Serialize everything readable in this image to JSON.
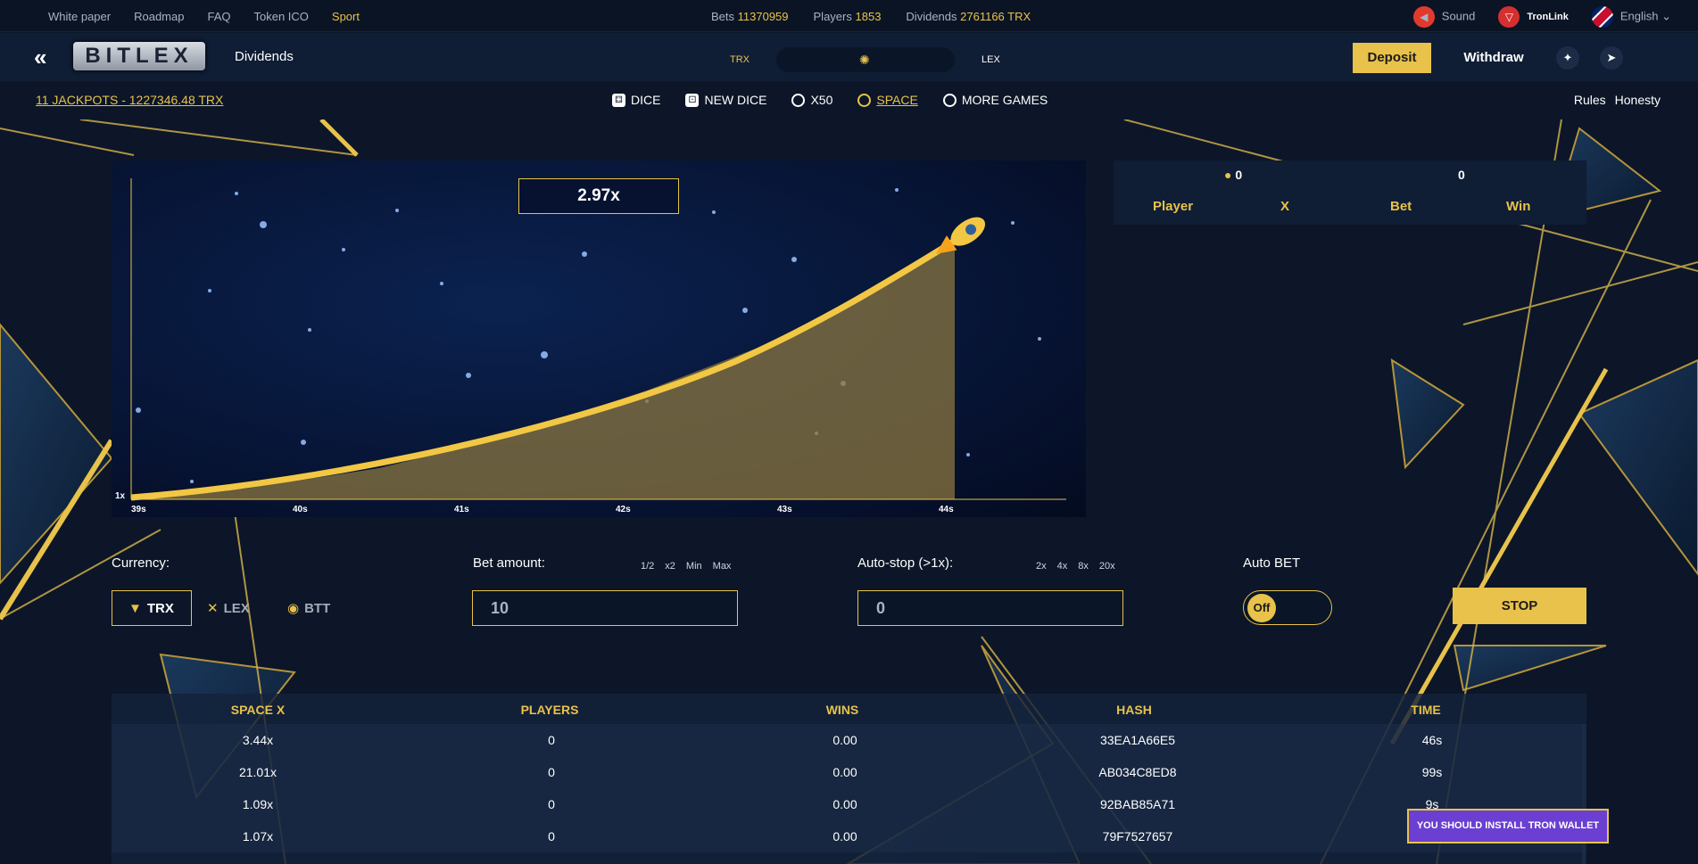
{
  "topbar": {
    "links": [
      "White paper",
      "Roadmap",
      "FAQ",
      "Token ICO",
      "Sport"
    ],
    "bets_label": "Bets",
    "bets_value": "11370959",
    "players_label": "Players",
    "players_value": "1853",
    "dividends_label": "Dividends",
    "dividends_value": "2761166 TRX",
    "sound_label": "Sound",
    "tronlink_label": "TronLink",
    "language": "English"
  },
  "header": {
    "logo_text": "BITLEX",
    "dividends_link": "Dividends",
    "swap_left": "TRX",
    "swap_right": "LEX",
    "deposit": "Deposit",
    "withdraw": "Withdraw"
  },
  "nav": {
    "jackpot": "11 JACKPOTS - 1227346.48 TRX",
    "games": [
      "DICE",
      "NEW DICE",
      "X50",
      "SPACE",
      "MORE GAMES"
    ],
    "rules": "Rules",
    "honesty": "Honesty"
  },
  "game": {
    "multiplier": "2.97x",
    "y_label": "1x",
    "x_ticks": [
      "39s",
      "40s",
      "41s",
      "42s",
      "43s",
      "44s"
    ]
  },
  "players_panel": {
    "player_count": "0",
    "bet_count": "0",
    "headers": [
      "Player",
      "X",
      "Bet",
      "Win"
    ]
  },
  "controls": {
    "currency_label": "Currency:",
    "currencies": [
      "TRX",
      "LEX",
      "BTT"
    ],
    "bet_label": "Bet amount:",
    "bet_quick": [
      "1/2",
      "x2",
      "Min",
      "Max"
    ],
    "bet_value": "10",
    "autostop_label": "Auto-stop (>1x):",
    "autostop_quick": [
      "2x",
      "4x",
      "8x",
      "20x"
    ],
    "autostop_value": "0",
    "autobet_label": "Auto BET",
    "autobet_state": "Off",
    "stop_button": "STOP"
  },
  "history": {
    "headers": [
      "SPACE X",
      "PLAYERS",
      "WINS",
      "HASH",
      "TIME"
    ],
    "rows": [
      [
        "3.44x",
        "0",
        "0.00",
        "33EA1A66E5",
        "46s"
      ],
      [
        "21.01x",
        "0",
        "0.00",
        "AB034C8ED8",
        "99s"
      ],
      [
        "1.09x",
        "0",
        "0.00",
        "92BAB85A71",
        "9s"
      ],
      [
        "1.07x",
        "0",
        "0.00",
        "79F7527657",
        ""
      ]
    ]
  },
  "toast": "YOU SHOULD INSTALL TRON WALLET",
  "colors": {
    "accent": "#e8c24a",
    "background": "#0c1628",
    "toast": "#6a3fd1"
  }
}
